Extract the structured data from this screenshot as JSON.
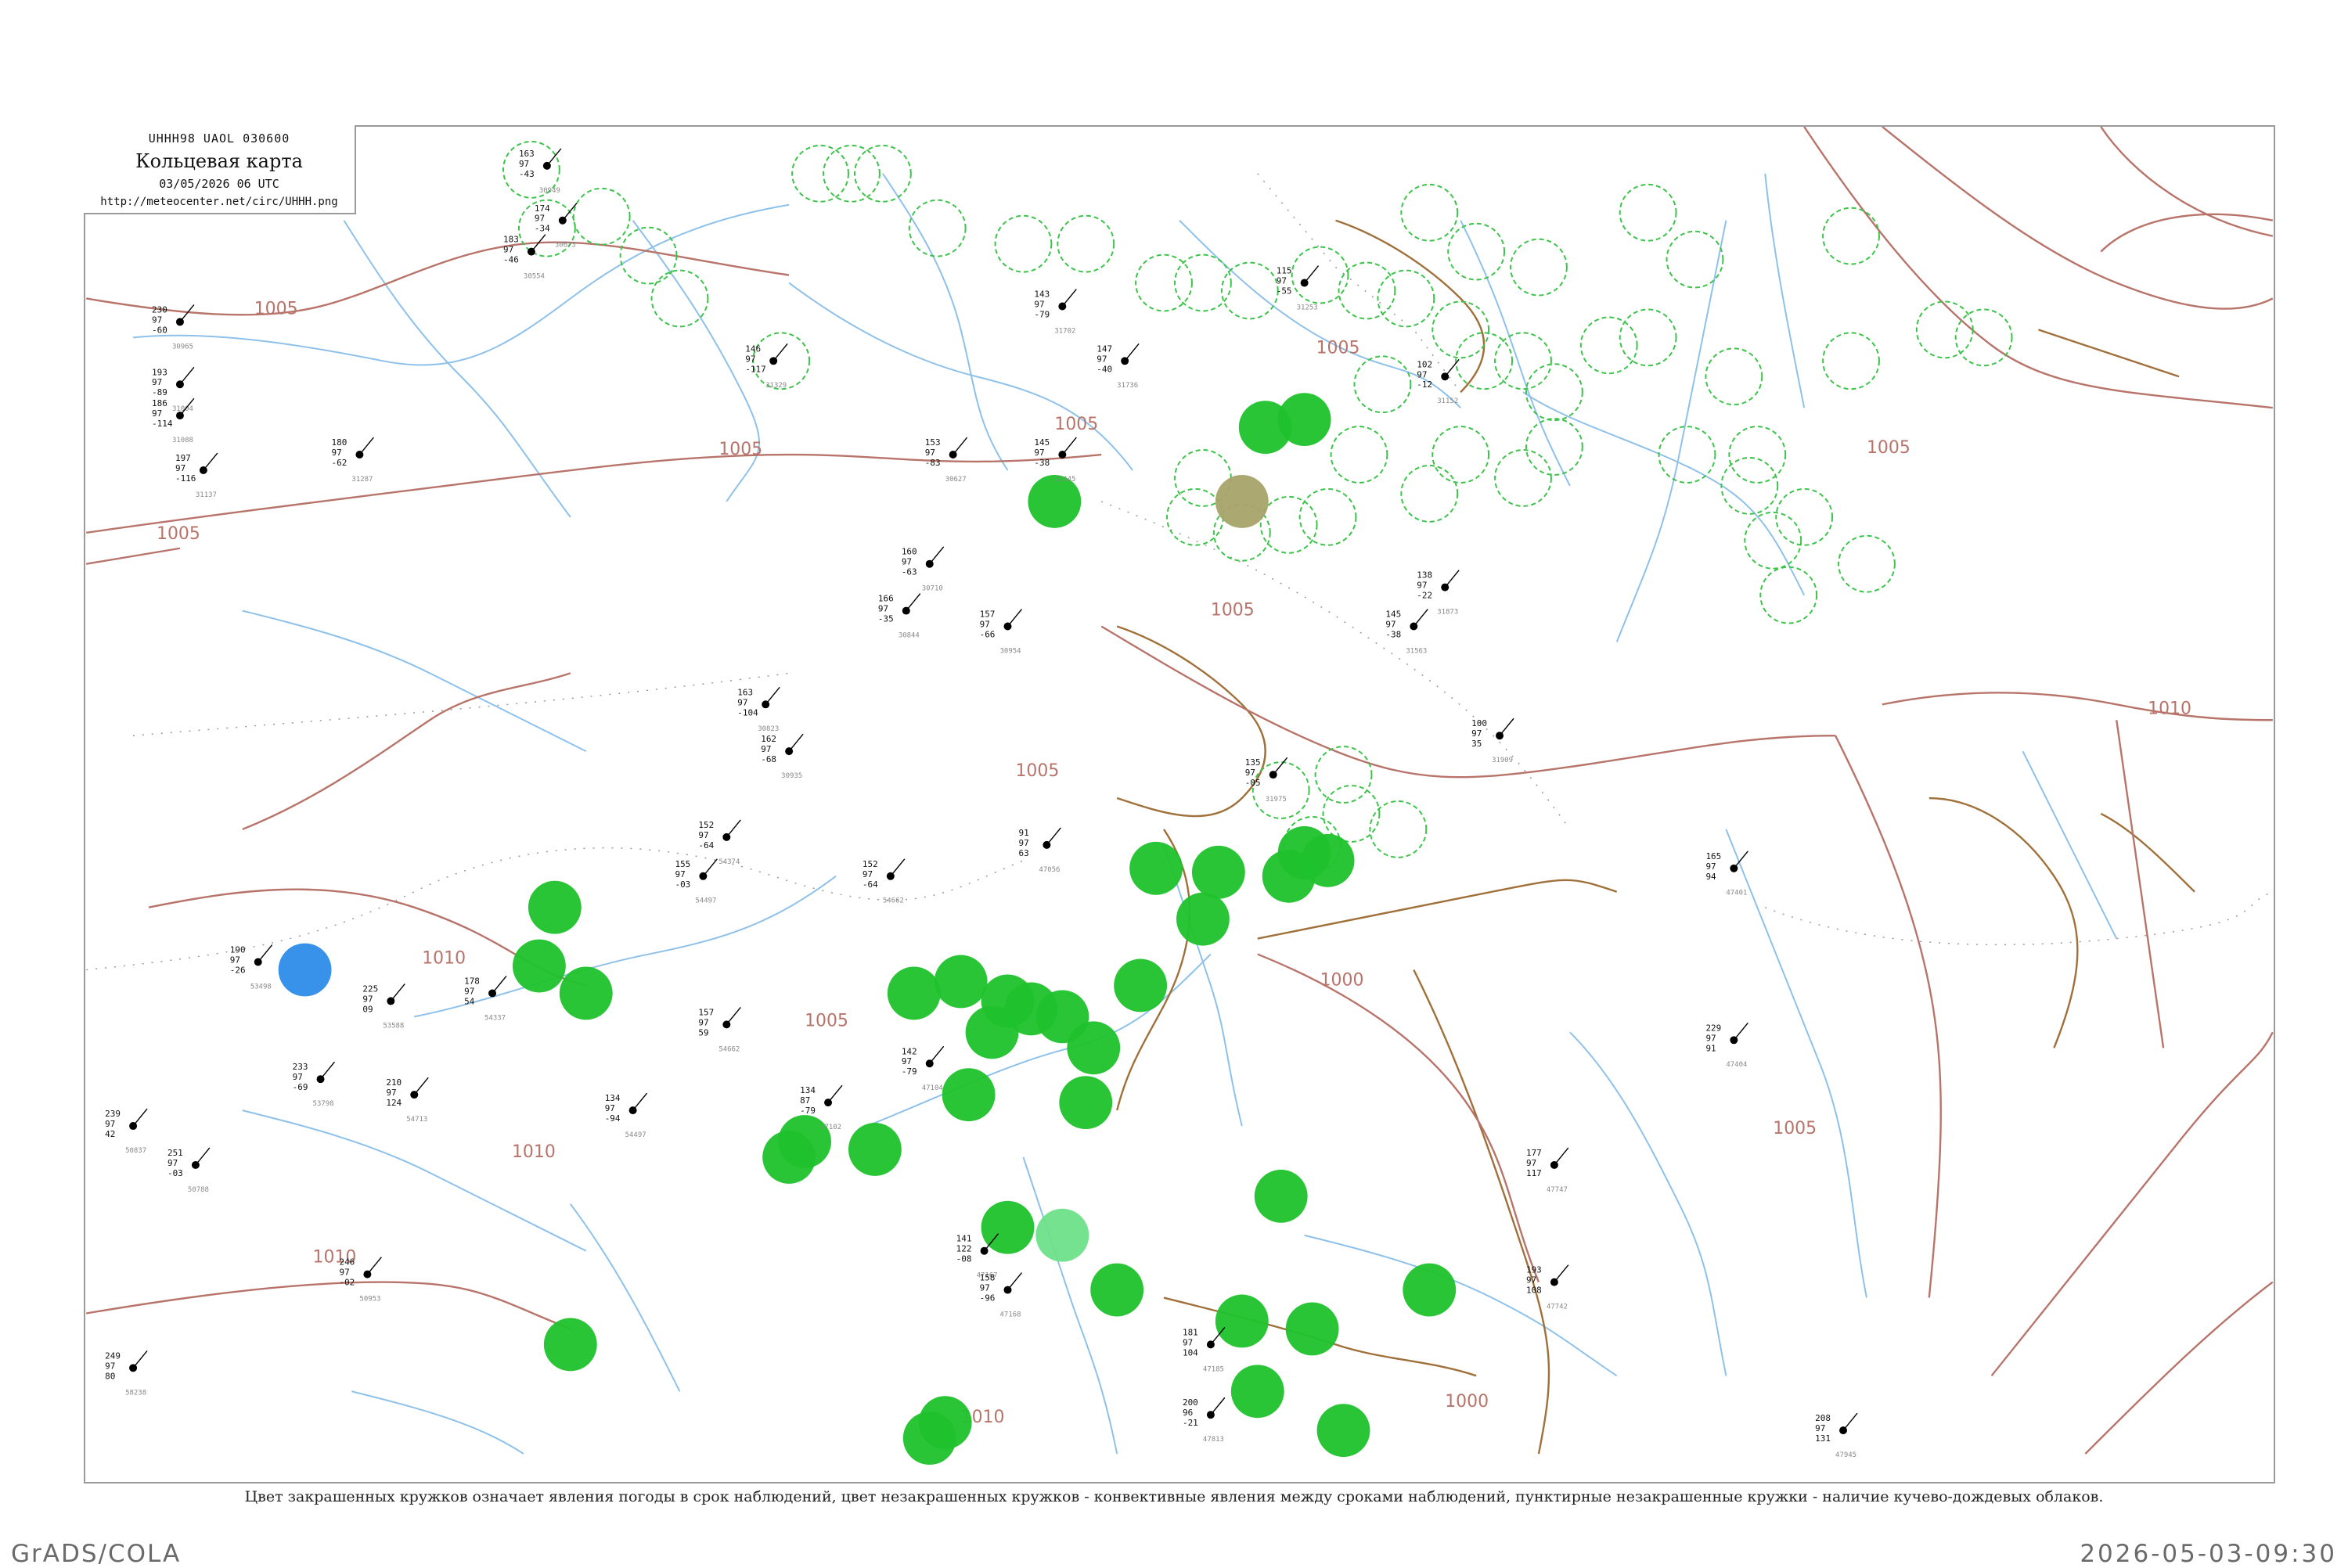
{
  "header": {
    "code": "UHHH98  UAOL  030600",
    "title": "Кольцевая карта",
    "time": "03/05/2026 06 UTC",
    "url": "http://meteocenter.net/circ/UHHH.png"
  },
  "isobar_labels": [
    "1005",
    "1005",
    "1005",
    "1005",
    "1005",
    "1005",
    "1005",
    "1005",
    "1005",
    "1005",
    "1010",
    "1010",
    "1010",
    "1010",
    "1000",
    "1000",
    "1010"
  ],
  "colors": {
    "rain_fill": "#1fc22c",
    "rain_light": "#6ee08a",
    "snow_fill": "#2d8ce8",
    "dust_fill": "#a8a36a",
    "cb_ring": "#3cc34a",
    "isobar": "#b8746a",
    "river": "#8ec1ea",
    "coast": "#a0703a"
  },
  "stations": [
    {
      "label": "230 97 -60",
      "id": "30965"
    },
    {
      "label": "193 97 -89",
      "id": "31004"
    },
    {
      "label": "186 97 -114",
      "id": "31088"
    },
    {
      "label": "197 97 -116",
      "id": "31137"
    },
    {
      "label": "180 97 -62",
      "id": "31287"
    },
    {
      "label": "183 97 -46",
      "id": "30554"
    },
    {
      "label": "174 97 -34",
      "id": "30673"
    },
    {
      "label": "163 97 -43",
      "id": "30949"
    },
    {
      "label": "146 97 -117",
      "id": "31329"
    },
    {
      "label": "153 97 -83",
      "id": "30627"
    },
    {
      "label": "160 97 -63",
      "id": "30710"
    },
    {
      "label": "166 97 -35",
      "id": "30844"
    },
    {
      "label": "157 97 -66",
      "id": "30954"
    },
    {
      "label": "163 97 -104",
      "id": "30823"
    },
    {
      "label": "162 97 -68",
      "id": "30935"
    },
    {
      "label": "145 97 -38",
      "id": "31445"
    },
    {
      "label": "143 97 -79",
      "id": "31702"
    },
    {
      "label": "147 97 -40",
      "id": "31736"
    },
    {
      "label": "115 97 -55",
      "id": "31253"
    },
    {
      "label": "102 97 -12",
      "id": "31152"
    },
    {
      "label": "138 97 -22",
      "id": "31873"
    },
    {
      "label": "100 97 35",
      "id": "31909"
    },
    {
      "label": "135 97 -05",
      "id": "31975"
    },
    {
      "label": "145 97 -38",
      "id": "31563"
    },
    {
      "label": "91 97 63",
      "id": "47056"
    },
    {
      "label": "142 97 -79",
      "id": "47104"
    },
    {
      "label": "134 87 -79",
      "id": "47102"
    },
    {
      "label": "141 122 -08",
      "id": "47167"
    },
    {
      "label": "190 97 -26",
      "id": "53498"
    },
    {
      "label": "225 97 09",
      "id": "53588"
    },
    {
      "label": "233 97 -69",
      "id": "53798"
    },
    {
      "label": "210 97 124",
      "id": "54713"
    },
    {
      "label": "178 97 54",
      "id": "54337"
    },
    {
      "label": "152 97 -64",
      "id": "54374"
    },
    {
      "label": "155 97 -03",
      "id": "54497"
    },
    {
      "label": "134 97 -94",
      "id": "54497"
    },
    {
      "label": "157 97 59",
      "id": "54662"
    },
    {
      "label": "152 97 -64",
      "id": "54662"
    },
    {
      "label": "158 97 -96",
      "id": "47168"
    },
    {
      "label": "181 97 104",
      "id": "47185"
    },
    {
      "label": "200 96 -21",
      "id": "47813"
    },
    {
      "label": "193 97 108",
      "id": "47742"
    },
    {
      "label": "165 97 94",
      "id": "47401"
    },
    {
      "label": "229 97 91",
      "id": "47404"
    },
    {
      "label": "177 97 117",
      "id": "47747"
    },
    {
      "label": "208 97 131",
      "id": "47945"
    },
    {
      "label": "249 97 80",
      "id": "58238"
    },
    {
      "label": "251 97 -03",
      "id": "50788"
    },
    {
      "label": "246 97 -02",
      "id": "50953"
    },
    {
      "label": "239 97 42",
      "id": "50837"
    }
  ],
  "caption": "Цвет закрашенных кружков означает явления погоды в срок наблюдений, цвет незакрашенных кружков - конвективные явления между сроками наблюдений, пунктирные незакрашенные кружки - наличие кучево-дождевых облаков.",
  "footer": {
    "left": "GrADS/COLA",
    "right": "2026-05-03-09:30"
  }
}
